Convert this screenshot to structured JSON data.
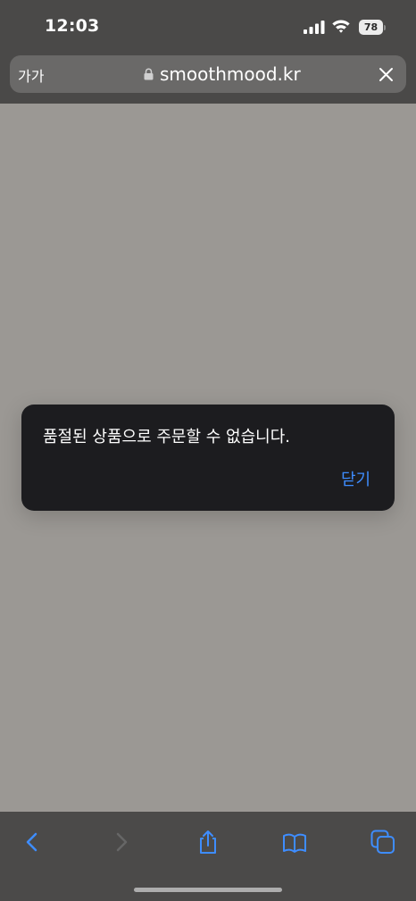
{
  "status_bar": {
    "time": "12:03",
    "battery_percent": "78",
    "signal_icon": "cellular-signal-icon",
    "wifi_icon": "wifi-icon",
    "battery_icon": "battery-icon"
  },
  "address_bar": {
    "text_size_label": "가가",
    "url": "smoothmood.kr",
    "lock_icon": "lock-icon",
    "close_icon": "close-icon"
  },
  "dialog": {
    "message": "품절된 상품으로 주문할 수 없습니다.",
    "close_label": "닫기"
  },
  "toolbar": {
    "back_icon": "chevron-left-icon",
    "forward_icon": "chevron-right-icon",
    "share_icon": "share-icon",
    "bookmarks_icon": "book-icon",
    "tabs_icon": "tabs-icon"
  },
  "colors": {
    "accent": "#3e8dff",
    "dialog_background": "#1c1c1f",
    "page_overlay": "#9b9894",
    "browser_chrome": "#4a4948"
  }
}
